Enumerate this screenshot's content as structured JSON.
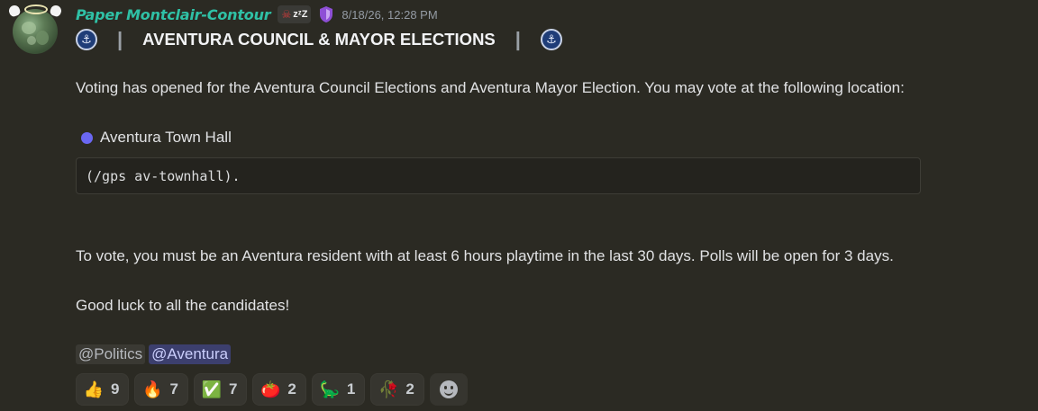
{
  "message": {
    "author": "Paper Montclair-Contour",
    "status_badge": "zᶻZ",
    "timestamp": "8/18/26, 12:28 PM",
    "title": "AVENTURA COUNCIL & MAYOR ELECTIONS",
    "title_separator": "|",
    "anchor_glyph": "⚓",
    "intro": "Voting has opened for the Aventura Council Elections and Aventura Mayor Election. You may vote at the following location:",
    "location_name": "Aventura Town Hall",
    "code_block": "(/gps av-townhall).",
    "requirements": "To vote, you must be an Aventura resident with at least 6 hours playtime in the last 30 days. Polls will be open for 3 days.",
    "closing": "Good luck to all the candidates!",
    "mentions": [
      "@Politics",
      "@Aventura"
    ]
  },
  "reactions": [
    {
      "emoji": "👍",
      "icon": "thumbs-up-icon",
      "count": "9"
    },
    {
      "emoji": "🔥",
      "icon": "fire-icon",
      "count": "7"
    },
    {
      "emoji": "✅",
      "icon": "check-mark-icon",
      "count": "7"
    },
    {
      "emoji": "🍅",
      "icon": "tomato-icon",
      "count": "2"
    },
    {
      "emoji": "🦕",
      "icon": "dinosaur-icon",
      "count": "1"
    },
    {
      "emoji": "🥀",
      "icon": "wilted-flower-icon",
      "count": "2"
    }
  ],
  "colors": {
    "background": "#2b2a23",
    "username": "#2fc1a6",
    "location_dot": "#6a67f2",
    "role_mention_bg": "#3c3f6e"
  }
}
